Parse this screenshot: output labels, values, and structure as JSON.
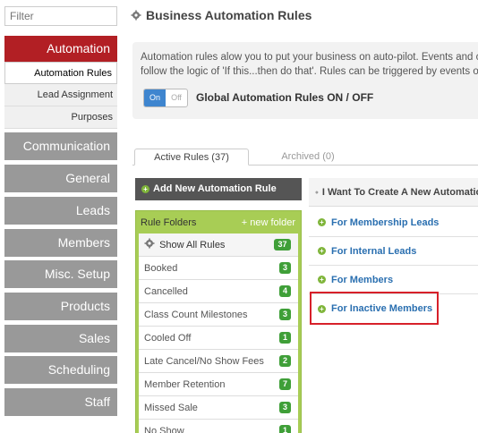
{
  "sidebar": {
    "filter_placeholder": "Filter",
    "active_section": "Automation",
    "sub_items": [
      {
        "label": "Automation Rules",
        "selected": true
      },
      {
        "label": "Lead Assignment",
        "selected": false
      },
      {
        "label": "Purposes",
        "selected": false
      }
    ],
    "sections": [
      "Communication",
      "General",
      "Leads",
      "Members",
      "Misc. Setup",
      "Products",
      "Sales",
      "Scheduling",
      "Staff"
    ]
  },
  "header": {
    "title": "Business Automation Rules",
    "title_icon": "gear-icon"
  },
  "info": {
    "line1": "Automation rules alow you to put your business on auto-pilot. Events and conditi",
    "line2": "follow the logic of 'If this...then do that'. Rules can be triggered by events or can sir",
    "toggle_on": "On",
    "toggle_off": "Off",
    "toggle_label": "Global Automation Rules ON / OFF"
  },
  "tabs": [
    {
      "label": "Active Rules (37)",
      "active": true
    },
    {
      "label": "Archived (0)",
      "active": false
    }
  ],
  "add_rule": {
    "label": "Add New Automation Rule"
  },
  "folders": {
    "header": "Rule Folders",
    "new_folder": "+ new folder",
    "items": [
      {
        "label": "Show All Rules",
        "count": "37"
      },
      {
        "label": "Booked",
        "count": "3"
      },
      {
        "label": "Cancelled",
        "count": "4"
      },
      {
        "label": "Class Count Milestones",
        "count": "3"
      },
      {
        "label": "Cooled Off",
        "count": "1"
      },
      {
        "label": "Late Cancel/No Show Fees",
        "count": "2"
      },
      {
        "label": "Member Retention",
        "count": "7"
      },
      {
        "label": "Missed Sale",
        "count": "3"
      },
      {
        "label": "No Show",
        "count": "1"
      }
    ]
  },
  "create": {
    "header": "I Want To Create A New Automation",
    "items": [
      "For Membership Leads",
      "For Internal Leads",
      "For Members",
      "For Inactive Members"
    ]
  },
  "colors": {
    "accent": "#b21f24",
    "link": "#2a6fb0",
    "folder_bg": "#a8cd55",
    "highlight": "#d7202a"
  }
}
